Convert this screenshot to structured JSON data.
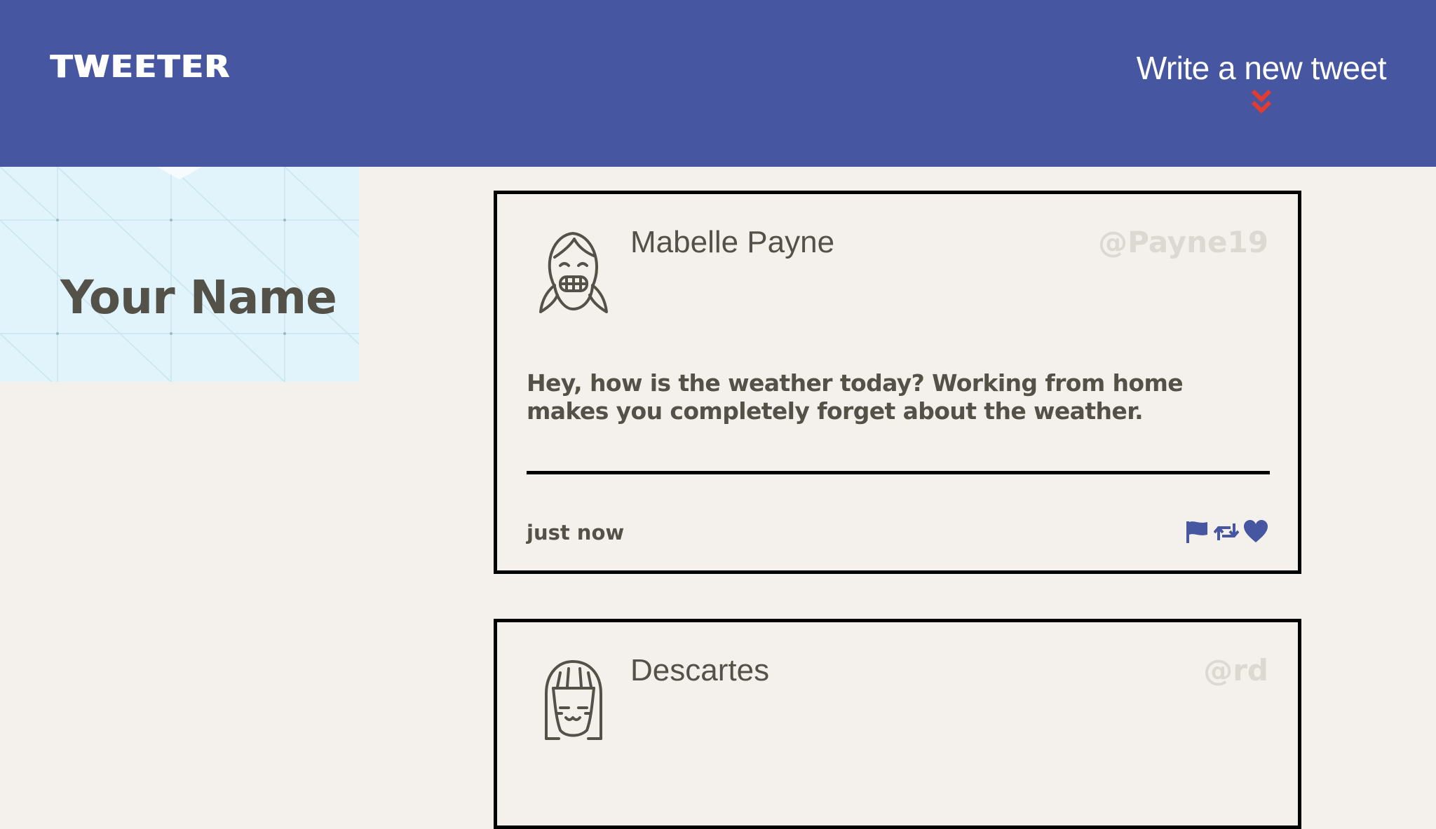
{
  "header": {
    "logo": "TWEETER",
    "compose_label": "Write a new tweet",
    "compose_icon": "double-chevron-down-icon"
  },
  "profile": {
    "name": "Your Name"
  },
  "tweets": [
    {
      "name": "Mabelle Payne",
      "handle": "@Payne19",
      "avatar": "grinning-girl-avatar",
      "body": "Hey, how is the weather today? Working from home makes you completely forget about the weather.",
      "time": "just now",
      "actions": [
        "flag-icon",
        "retweet-icon",
        "heart-icon"
      ]
    },
    {
      "name": "Descartes",
      "handle": "@rd",
      "avatar": "smiling-girl-avatar"
    }
  ],
  "colors": {
    "header_bg": "#4656a0",
    "page_bg": "#f4f1ec",
    "profile_bg": "#e1f4fc",
    "text": "#545149",
    "handle": "#dcd9d3",
    "accent_red": "#e23b2f",
    "action_icon": "#4656a0"
  }
}
